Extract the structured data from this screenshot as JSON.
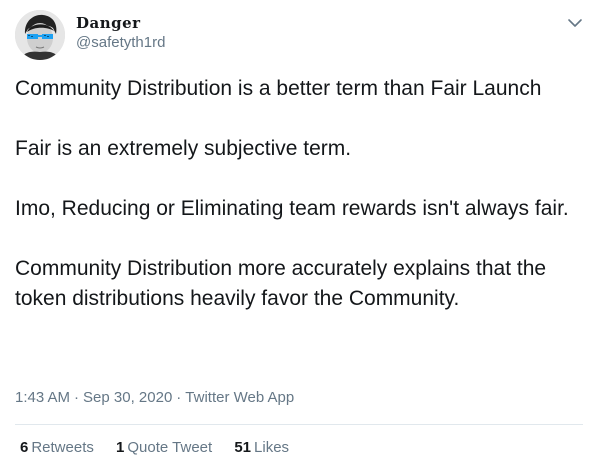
{
  "author": {
    "display_name": "Danger",
    "handle": "@safetyth1rd",
    "avatar_icon": "person-with-sunglasses-avatar"
  },
  "tweet": {
    "paragraphs": [
      "Community Distribution is a better term than Fair Launch",
      "Fair is an extremely subjective term.",
      "Imo, Reducing or Eliminating team rewards isn't always fair.",
      "Community Distribution more accurately explains that the token distributions heavily favor the Community."
    ]
  },
  "meta": {
    "time": "1:43 AM",
    "date": "Sep 30, 2020",
    "separator": "·",
    "source": "Twitter Web App"
  },
  "stats": {
    "retweets_count": "6",
    "retweets_label": "Retweets",
    "quote_count": "1",
    "quote_label": "Quote Tweet",
    "likes_count": "51",
    "likes_label": "Likes"
  },
  "colors": {
    "text": "#14171a",
    "secondary": "#657786",
    "divider": "#e1e8ed",
    "sunglasses": "#1da1f2"
  }
}
